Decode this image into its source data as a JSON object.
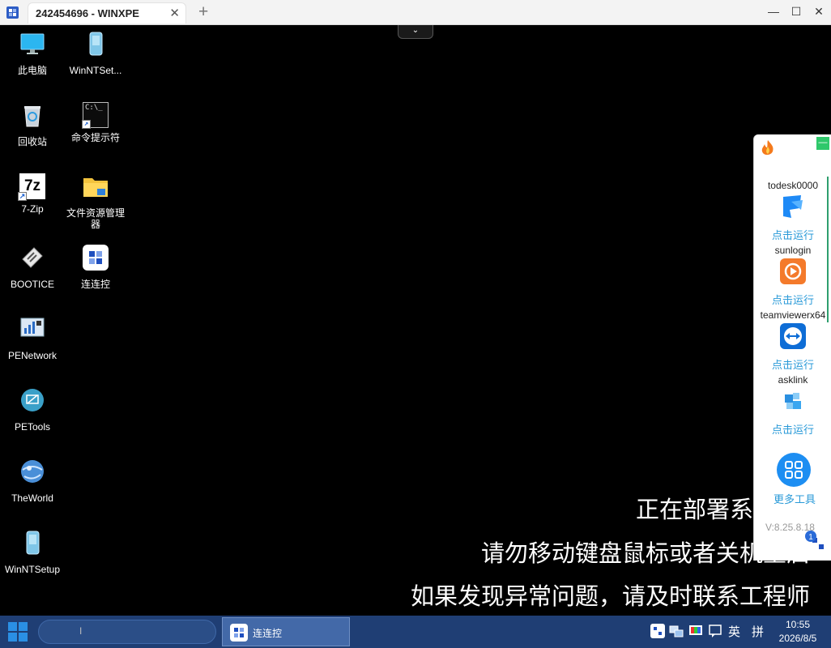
{
  "window": {
    "tab_title": "242454696 - WINXPE",
    "close_tab": "✕",
    "new_tab": "+",
    "controls": {
      "minimize": "—",
      "maximize": "☐",
      "close": "✕"
    },
    "collapse": "⌄"
  },
  "desktop": {
    "icons": [
      {
        "label": "此电脑",
        "icon": "computer-icon"
      },
      {
        "label": "WinNTSet...",
        "icon": "setup-icon"
      },
      {
        "label": "回收站",
        "icon": "recycle-bin-icon"
      },
      {
        "label": "命令提示符",
        "icon": "cmd-icon"
      },
      {
        "label": "7-Zip",
        "icon": "7zip-icon"
      },
      {
        "label": "文件资源管理器",
        "icon": "folder-icon"
      },
      {
        "label": "BOOTICE",
        "icon": "bootice-icon"
      },
      {
        "label": "连连控",
        "icon": "lianliankong-icon"
      },
      {
        "label": "PENetwork",
        "icon": "network-icon"
      },
      {
        "label": "PETools",
        "icon": "petools-icon"
      },
      {
        "label": "TheWorld",
        "icon": "browser-icon"
      },
      {
        "label": "WinNTSetup",
        "icon": "setup-icon"
      }
    ]
  },
  "panel": {
    "minimize": "—",
    "tools": [
      {
        "name": "todesk0000",
        "action": "点击运行",
        "icon": "todesk-icon"
      },
      {
        "name": "sunlogin",
        "action": "点击运行",
        "icon": "sunlogin-icon"
      },
      {
        "name": "teamviewerx64",
        "action": "点击运行",
        "icon": "teamviewer-icon"
      },
      {
        "name": "asklink",
        "action": "点击运行",
        "icon": "asklink-icon"
      }
    ],
    "more_label": "更多工具",
    "version": "V:8.25.8.18"
  },
  "notification_badge": "1",
  "overlay": {
    "line1": "正在部署系",
    "line2": "请勿移动键盘鼠标或者关机重启",
    "line3": "如果发现异常问题，请及时联系工程师"
  },
  "taskbar": {
    "search_caret": "I",
    "task_label": "连连控",
    "ime_lang": "英",
    "ime_mode": "拼",
    "time": "10:55",
    "date": "2026/8/5"
  },
  "colors": {
    "taskbar": "#1f3e74",
    "accent": "#2a9ad8",
    "panel_green": "#2fc86b"
  }
}
